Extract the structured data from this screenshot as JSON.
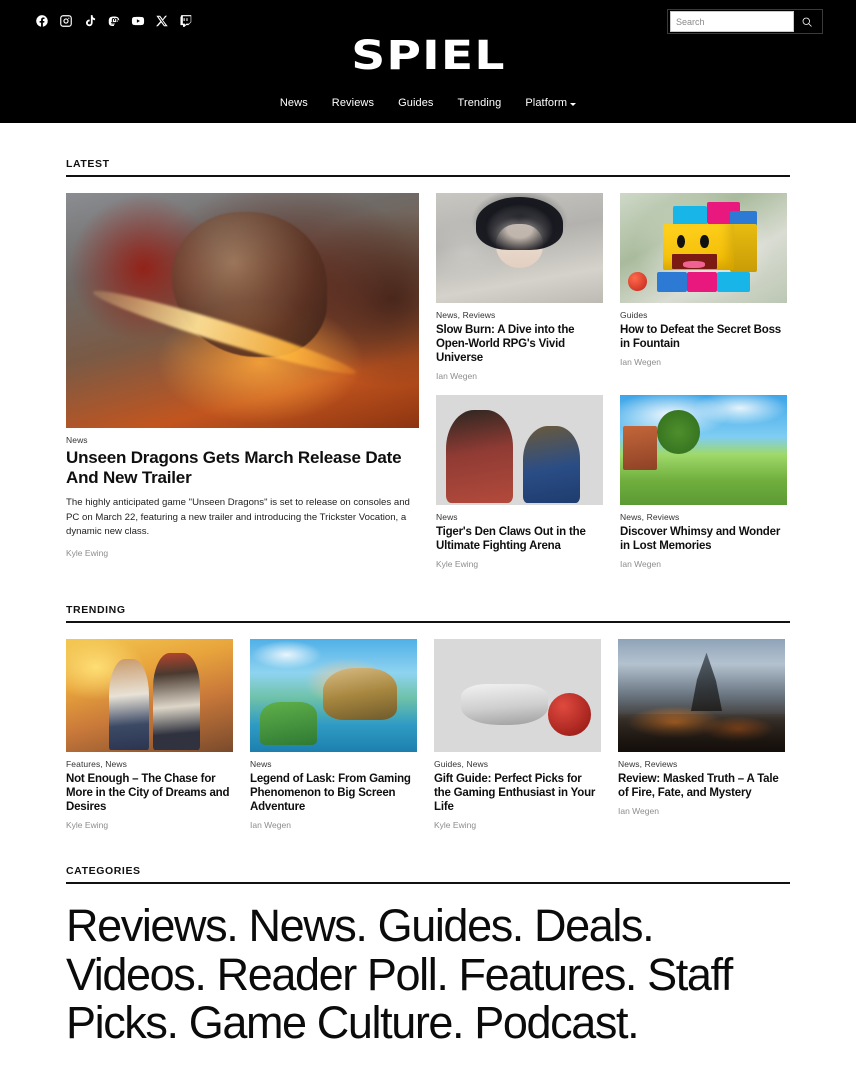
{
  "header": {
    "brand": "SPIEL",
    "social": [
      {
        "name": "facebook-icon",
        "label": "Facebook"
      },
      {
        "name": "instagram-icon",
        "label": "Instagram"
      },
      {
        "name": "tiktok-icon",
        "label": "TikTok"
      },
      {
        "name": "mastodon-icon",
        "label": "Mastodon"
      },
      {
        "name": "youtube-icon",
        "label": "YouTube"
      },
      {
        "name": "x-twitter-icon",
        "label": "X"
      },
      {
        "name": "twitch-icon",
        "label": "Twitch"
      }
    ],
    "search": {
      "placeholder": "Search",
      "value": "",
      "button_icon": "search-icon"
    },
    "nav": [
      {
        "label": "News",
        "has_dropdown": false
      },
      {
        "label": "Reviews",
        "has_dropdown": false
      },
      {
        "label": "Guides",
        "has_dropdown": false
      },
      {
        "label": "Trending",
        "has_dropdown": false
      },
      {
        "label": "Platform",
        "has_dropdown": true
      }
    ]
  },
  "latest": {
    "section_title": "LATEST",
    "featured": {
      "categories": "News",
      "title": "Unseen Dragons Gets March Release Date And New Trailer",
      "excerpt": "The highly anticipated game \"Unseen Dragons\" is set to release on consoles and PC on March 22, featuring a new trailer and introducing the Trickster Vocation, a dynamic new class.",
      "author": "Kyle Ewing",
      "image_alt": "red-dragon-with-flaming-sword"
    },
    "cards": [
      {
        "categories": "News, Reviews",
        "title": "Slow Burn: A Dive into the Open-World RPG's Vivid Universe",
        "author": "Ian Wegen",
        "image_alt": "anime-girl-with-dark-hair"
      },
      {
        "categories": "Guides",
        "title": "How to Defeat the Secret Boss in Fountain",
        "author": "Ian Wegen",
        "image_alt": "yellow-lego-block-character"
      },
      {
        "categories": "News",
        "title": "Tiger's Den Claws Out in the Ultimate Fighting Arena",
        "author": "Kyle Ewing",
        "image_alt": "two-fighters-facing-off"
      },
      {
        "categories": "News, Reviews",
        "title": "Discover Whimsy and Wonder in Lost Memories",
        "author": "Ian Wegen",
        "image_alt": "colorful-cartoon-village"
      }
    ]
  },
  "trending": {
    "section_title": "TRENDING",
    "cards": [
      {
        "categories": "Features, News",
        "title": "Not Enough – The Chase for More in the City of Dreams and Desires",
        "author": "Kyle Ewing",
        "image_alt": "couple-in-sunny-city"
      },
      {
        "categories": "News",
        "title": "Legend of Lask: From Gaming Phenomenon to Big Screen Adventure",
        "author": "Ian Wegen",
        "image_alt": "tropical-island-fantasy"
      },
      {
        "categories": "Guides, News",
        "title": "Gift Guide: Perfect Picks for the Gaming Enthusiast in Your Life",
        "author": "Kyle Ewing",
        "image_alt": "game-controller-with-ornaments"
      },
      {
        "categories": "News, Reviews",
        "title": "Review: Masked Truth – A Tale of Fire, Fate, and Mystery",
        "author": "Ian Wegen",
        "image_alt": "dark-fiery-mountain-landscape"
      }
    ]
  },
  "categories": {
    "section_title": "CATEGORIES",
    "terms": [
      "Reviews.",
      "News.",
      "Guides.",
      "Deals.",
      "Videos.",
      "Reader Poll.",
      "Features.",
      "Staff Picks.",
      "Game Culture.",
      "Podcast."
    ]
  },
  "colors": {
    "header_bg": "#000000",
    "page_bg": "#ffffff",
    "text": "#0f0f0f",
    "muted": "#8d8d8d",
    "rule": "#111111"
  }
}
